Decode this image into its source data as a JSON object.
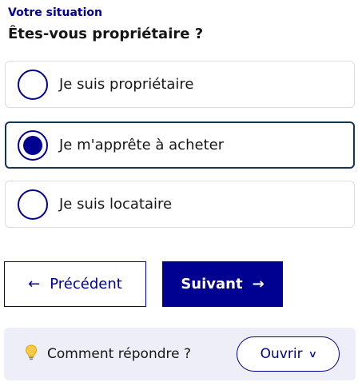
{
  "header": {
    "eyebrow": "Votre situation",
    "question": "Êtes-vous propriétaire ?"
  },
  "options": [
    {
      "label": "Je suis propriétaire",
      "selected": false
    },
    {
      "label": "Je m'apprête à acheter",
      "selected": true
    },
    {
      "label": "Je suis locataire",
      "selected": false
    }
  ],
  "nav": {
    "prev_label": "Précédent",
    "next_label": "Suivant",
    "prev_icon": "arrow-left-icon",
    "next_icon": "arrow-right-icon"
  },
  "help": {
    "icon": "lightbulb-icon",
    "text": "Comment répondre ?",
    "open_label": "Ouvrir",
    "open_icon": "chevron-down-icon"
  },
  "colors": {
    "primary": "#000091",
    "selected_border": "#15384f",
    "help_background": "#eeeef8"
  }
}
